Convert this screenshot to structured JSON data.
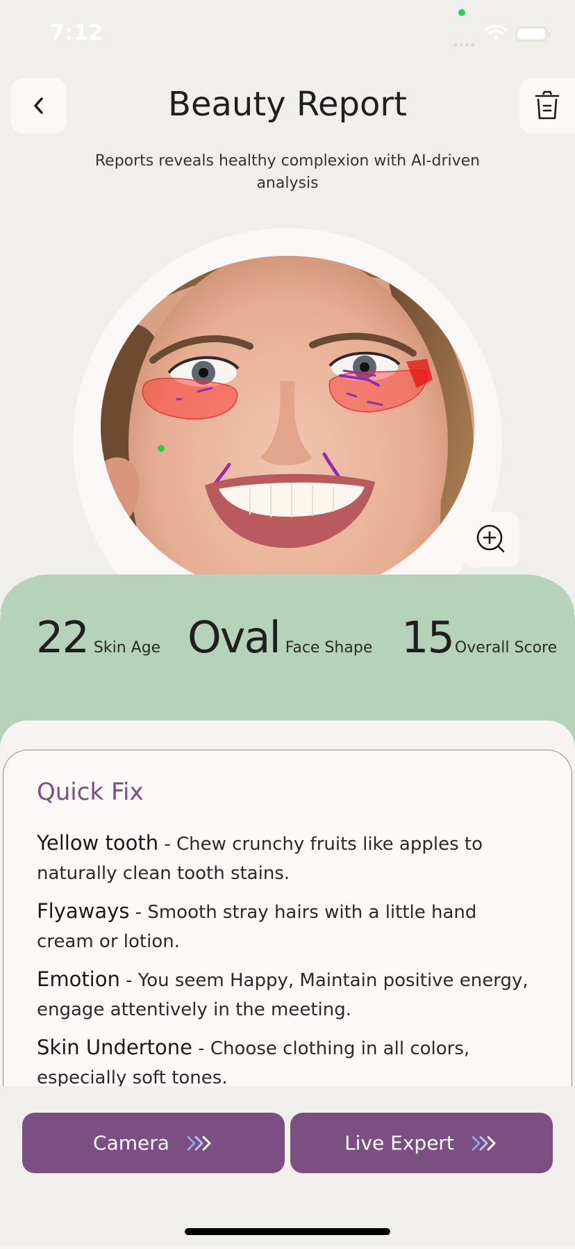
{
  "status_bar": {
    "time": "7:12"
  },
  "header": {
    "title": "Beauty Report",
    "subtitle": "Reports reveals healthy complexion with AI-driven analysis"
  },
  "stats": [
    {
      "value": "22",
      "label": "Skin Age"
    },
    {
      "value": "Oval",
      "label": "Face Shape"
    },
    {
      "value": "15",
      "label": "Overall Score"
    }
  ],
  "quick_fix": {
    "title": "Quick Fix",
    "items": [
      {
        "key": "Yellow tooth",
        "text": " - Chew crunchy fruits like apples to naturally clean tooth stains."
      },
      {
        "key": "Flyaways",
        "text": " - Smooth stray hairs with a little hand cream or lotion."
      },
      {
        "key": "Emotion",
        "text": " - You seem Happy, Maintain positive energy, engage attentively in the meeting."
      },
      {
        "key": "Skin Undertone",
        "text": " - Choose clothing in all colors, especially soft tones."
      }
    ]
  },
  "actions": {
    "camera": "Camera",
    "live_expert": "Live Expert"
  },
  "colors": {
    "accent_purple": "#7b4f81",
    "stats_green": "#b6d3b9",
    "background": "#f0efeb"
  }
}
